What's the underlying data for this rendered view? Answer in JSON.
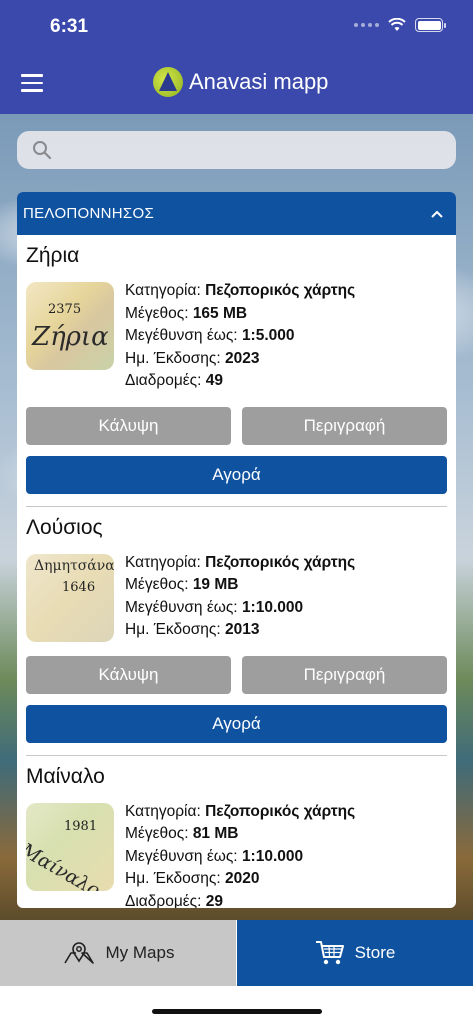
{
  "status_bar": {
    "time": "6:31"
  },
  "app_bar": {
    "title": "Anavasi mapp"
  },
  "search": {
    "placeholder": "",
    "value": ""
  },
  "region": {
    "title": "ΠΕΛΟΠΟΝΝΗΣΟΣ"
  },
  "labels": {
    "category": "Κατηγορία:",
    "size": "Μέγεθος:",
    "zoom": "Μεγέθυνση έως:",
    "release": "Ημ. Έκδοσης:",
    "routes": "Διαδρομές:"
  },
  "maps": [
    {
      "title": "Ζήρια",
      "thumb_number": "2375",
      "thumb_name": "Ζήρια",
      "category": "Πεζοπορικός χάρτης",
      "size": "165 MB",
      "zoom": "1:5.000",
      "release": "2023",
      "routes": "49",
      "coverage_label": "Κάλυψη",
      "description_label": "Περιγραφή",
      "buy_label": "Αγορά"
    },
    {
      "title": "Λούσιος",
      "thumb_number": "1646",
      "thumb_name": "Δημητσάνα",
      "category": "Πεζοπορικός χάρτης",
      "size": "19 MB",
      "zoom": "1:10.000",
      "release": "2013",
      "coverage_label": "Κάλυψη",
      "description_label": "Περιγραφή",
      "buy_label": "Αγορά"
    },
    {
      "title": "Μαίναλο",
      "thumb_number": "1981",
      "thumb_name": "Μαίναλο",
      "category": "Πεζοπορικός χάρτης",
      "size": "81 MB",
      "zoom": "1:10.000",
      "release": "2020",
      "routes": "29"
    }
  ],
  "tabs": {
    "my_maps": "My Maps",
    "store": "Store"
  },
  "colors": {
    "primary": "#3a49ab",
    "accent_blue": "#0f52a0",
    "button_gray": "#9e9e9e"
  }
}
